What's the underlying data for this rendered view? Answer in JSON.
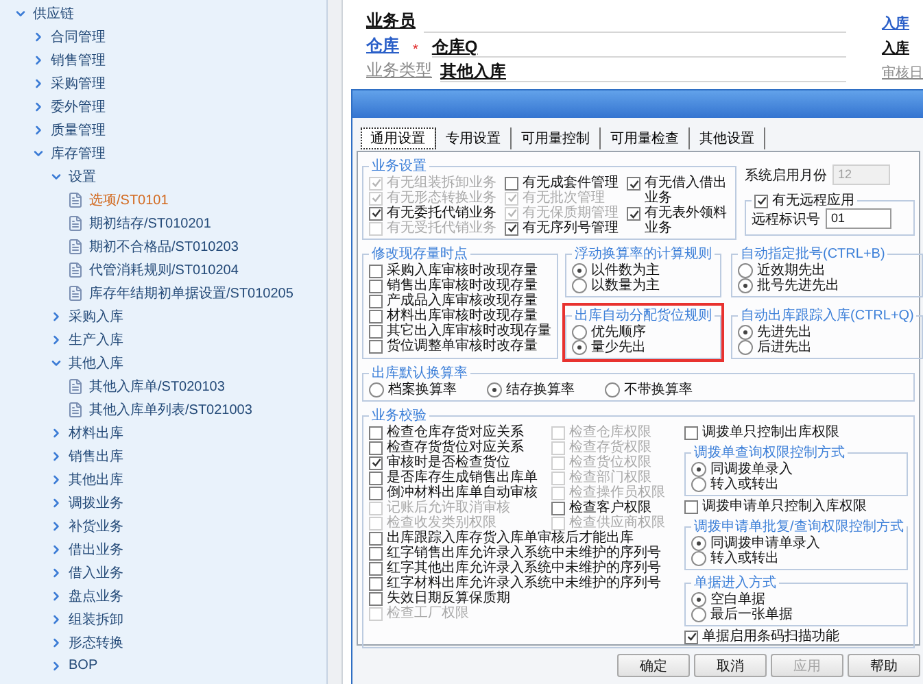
{
  "sidebar": {
    "items": [
      {
        "label": "供应链",
        "kind": "folder",
        "expanded": true,
        "children": [
          {
            "label": "合同管理",
            "kind": "folder",
            "expanded": false
          },
          {
            "label": "销售管理",
            "kind": "folder",
            "expanded": false
          },
          {
            "label": "采购管理",
            "kind": "folder",
            "expanded": false
          },
          {
            "label": "委外管理",
            "kind": "folder",
            "expanded": false
          },
          {
            "label": "质量管理",
            "kind": "folder",
            "expanded": false
          },
          {
            "label": "库存管理",
            "kind": "folder",
            "expanded": true,
            "children": [
              {
                "label": "设置",
                "kind": "folder",
                "expanded": true,
                "children": [
                  {
                    "label": "选项/ST0101",
                    "kind": "page",
                    "selected": true
                  },
                  {
                    "label": "期初结存/ST010201",
                    "kind": "page",
                    "selected": false
                  },
                  {
                    "label": "期初不合格品/ST010203",
                    "kind": "page",
                    "selected": false
                  },
                  {
                    "label": "代管消耗规则/ST010204",
                    "kind": "page",
                    "selected": false
                  },
                  {
                    "label": "库存年结期初单据设置/ST010205",
                    "kind": "page",
                    "selected": false
                  }
                ]
              },
              {
                "label": "采购入库",
                "kind": "folder",
                "expanded": false
              },
              {
                "label": "生产入库",
                "kind": "folder",
                "expanded": false
              },
              {
                "label": "其他入库",
                "kind": "folder",
                "expanded": true,
                "children": [
                  {
                    "label": "其他入库单/ST020103",
                    "kind": "page",
                    "selected": false
                  },
                  {
                    "label": "其他入库单列表/ST021003",
                    "kind": "page",
                    "selected": false
                  }
                ]
              },
              {
                "label": "材料出库",
                "kind": "folder",
                "expanded": false
              },
              {
                "label": "销售出库",
                "kind": "folder",
                "expanded": false
              },
              {
                "label": "其他出库",
                "kind": "folder",
                "expanded": false
              },
              {
                "label": "调拨业务",
                "kind": "folder",
                "expanded": false
              },
              {
                "label": "补货业务",
                "kind": "folder",
                "expanded": false
              },
              {
                "label": "借出业务",
                "kind": "folder",
                "expanded": false
              },
              {
                "label": "借入业务",
                "kind": "folder",
                "expanded": false
              },
              {
                "label": "盘点业务",
                "kind": "folder",
                "expanded": false
              },
              {
                "label": "组装拆卸",
                "kind": "folder",
                "expanded": false
              },
              {
                "label": "形态转换",
                "kind": "folder",
                "expanded": false
              },
              {
                "label": "BOP",
                "kind": "folder",
                "expanded": false
              }
            ]
          }
        ]
      }
    ]
  },
  "form": {
    "left": [
      {
        "label": "业务员",
        "kind": "plain"
      },
      {
        "label": "仓库",
        "kind": "link",
        "required_mark": "*",
        "value": "仓库Q"
      },
      {
        "label": "业务类型",
        "kind": "muted",
        "value": "其他入库"
      }
    ],
    "right": [
      {
        "label": "入库",
        "kind": "link"
      },
      {
        "label": "入库",
        "kind": "plain"
      },
      {
        "label": "审核日",
        "kind": "muted"
      }
    ]
  },
  "dialog": {
    "tabs": [
      {
        "label": "通用设置",
        "selected": true
      },
      {
        "label": "专用设置",
        "selected": false
      },
      {
        "label": "可用量控制",
        "selected": false
      },
      {
        "label": "可用量检查",
        "selected": false
      },
      {
        "label": "其他设置",
        "selected": false
      }
    ],
    "business_settings": {
      "title": "业务设置",
      "columns": [
        [
          {
            "label": "有无组装拆卸业务",
            "checked": true,
            "disabled": true
          },
          {
            "label": "有无形态转换业务",
            "checked": true,
            "disabled": true
          },
          {
            "label": "有无委托代销业务",
            "checked": true,
            "disabled": false
          },
          {
            "label": "有无受托代销业务",
            "checked": false,
            "disabled": true
          }
        ],
        [
          {
            "label": "有无成套件管理",
            "checked": false,
            "disabled": false
          },
          {
            "label": "有无批次管理",
            "checked": true,
            "disabled": true
          },
          {
            "label": "有无保质期管理",
            "checked": true,
            "disabled": true
          },
          {
            "label": "有无序列号管理",
            "checked": true,
            "disabled": false
          }
        ],
        [
          {
            "label": "有无借入借出业务",
            "checked": true,
            "disabled": false
          },
          {
            "label": "有无表外领料业务",
            "checked": true,
            "disabled": false
          }
        ]
      ]
    },
    "start_month": {
      "label": "系统启用月份",
      "value": "12",
      "disabled": true
    },
    "remote": {
      "checkbox": {
        "label": "有无远程应用",
        "checked": true,
        "disabled": false
      },
      "field": {
        "label": "远程标识号",
        "value": "01"
      }
    },
    "stock_update": {
      "title": "修改现存量时点",
      "options": [
        {
          "label": "采购入库审核时改现存量",
          "checked": false,
          "disabled": false
        },
        {
          "label": "销售出库审核时改现存量",
          "checked": false,
          "disabled": false
        },
        {
          "label": "产成品入库审核改现存量",
          "checked": false,
          "disabled": false
        },
        {
          "label": "材料出库审核时改现存量",
          "checked": false,
          "disabled": false
        },
        {
          "label": "其它出入库审核时改现存量",
          "checked": false,
          "disabled": false
        },
        {
          "label": "货位调整单审核时改存量",
          "checked": false,
          "disabled": false
        }
      ]
    },
    "rule_groups": [
      {
        "title": "浮动换算率的计算规则",
        "highlighted": false,
        "options": [
          {
            "label": "以件数为主",
            "selected": true
          },
          {
            "label": "以数量为主",
            "selected": false
          }
        ]
      },
      {
        "title": "自动指定批号(CTRL+B)",
        "highlighted": false,
        "options": [
          {
            "label": "近效期先出",
            "selected": false
          },
          {
            "label": "批号先进先出",
            "selected": true
          }
        ]
      },
      {
        "title": "出库自动分配货位规则",
        "highlighted": true,
        "options": [
          {
            "label": "优先顺序",
            "selected": false
          },
          {
            "label": "量少先出",
            "selected": true
          }
        ]
      },
      {
        "title": "自动出库跟踪入库(CTRL+Q)",
        "highlighted": false,
        "options": [
          {
            "label": "先进先出",
            "selected": true
          },
          {
            "label": "后进先出",
            "selected": false
          }
        ]
      }
    ],
    "default_rate": {
      "title": "出库默认换算率",
      "options": [
        {
          "label": "档案换算率",
          "selected": false
        },
        {
          "label": "结存换算率",
          "selected": true
        },
        {
          "label": "不带换算率",
          "selected": false
        }
      ]
    },
    "validation": {
      "title": "业务校验",
      "columns": [
        [
          {
            "label": "检查仓库存货对应关系",
            "checked": false,
            "disabled": false
          },
          {
            "label": "检查存货货位对应关系",
            "checked": false,
            "disabled": false
          },
          {
            "label": "审核时是否检查货位",
            "checked": true,
            "disabled": false
          },
          {
            "label": "是否库存生成销售出库单",
            "checked": false,
            "disabled": false
          },
          {
            "label": "倒冲材料出库单自动审核",
            "checked": false,
            "disabled": false
          },
          {
            "label": "记账后允许取消审核",
            "checked": false,
            "disabled": true
          },
          {
            "label": "检查收发类别权限",
            "checked": false,
            "disabled": true
          }
        ],
        [
          {
            "label": "检查仓库权限",
            "checked": false,
            "disabled": true
          },
          {
            "label": "检查存货权限",
            "checked": false,
            "disabled": true
          },
          {
            "label": "检查货位权限",
            "checked": false,
            "disabled": true
          },
          {
            "label": "检查部门权限",
            "checked": false,
            "disabled": true
          },
          {
            "label": "检查操作员权限",
            "checked": false,
            "disabled": true
          },
          {
            "label": "检查客户权限",
            "checked": false,
            "disabled": false
          },
          {
            "label": "检查供应商权限",
            "checked": false,
            "disabled": true
          }
        ]
      ],
      "wide": [
        {
          "label": "出库跟踪入库存货入库单审核后才能出库",
          "checked": false,
          "disabled": false
        },
        {
          "label": "红字销售出库允许录入系统中未维护的序列号",
          "checked": false,
          "disabled": false
        },
        {
          "label": "红字其他出库允许录入系统中未维护的序列号",
          "checked": false,
          "disabled": false
        },
        {
          "label": "红字材料出库允许录入系统中未维护的序列号",
          "checked": false,
          "disabled": false
        },
        {
          "label": "失效日期反算保质期",
          "checked": false,
          "disabled": false
        },
        {
          "label": "检查工厂权限",
          "checked": false,
          "disabled": true
        }
      ],
      "side": [
        {
          "kind": "checkbox",
          "label": "调拨单只控制出库权限",
          "checked": false,
          "disabled": false
        },
        {
          "kind": "radio_group",
          "title": "调拨单查询权限控制方式",
          "options": [
            {
              "label": "同调拨单录入",
              "selected": true
            },
            {
              "label": "转入或转出",
              "selected": false
            }
          ]
        },
        {
          "kind": "checkbox",
          "label": "调拨申请单只控制入库权限",
          "checked": false,
          "disabled": false
        },
        {
          "kind": "radio_group",
          "title": "调拨申请单批复/查询权限控制方式",
          "options": [
            {
              "label": "同调拨申请单录入",
              "selected": true
            },
            {
              "label": "转入或转出",
              "selected": false
            }
          ]
        },
        {
          "kind": "radio_group",
          "title": "单据进入方式",
          "options": [
            {
              "label": "空白单据",
              "selected": true
            },
            {
              "label": "最后一张单据",
              "selected": false
            }
          ]
        },
        {
          "kind": "checkbox",
          "label": "单据启用条码扫描功能",
          "checked": true,
          "disabled": false
        }
      ]
    },
    "buttons": [
      {
        "label": "确定",
        "disabled": false
      },
      {
        "label": "取消",
        "disabled": false
      },
      {
        "label": "应用",
        "disabled": true
      },
      {
        "label": "帮助",
        "disabled": false
      }
    ]
  }
}
